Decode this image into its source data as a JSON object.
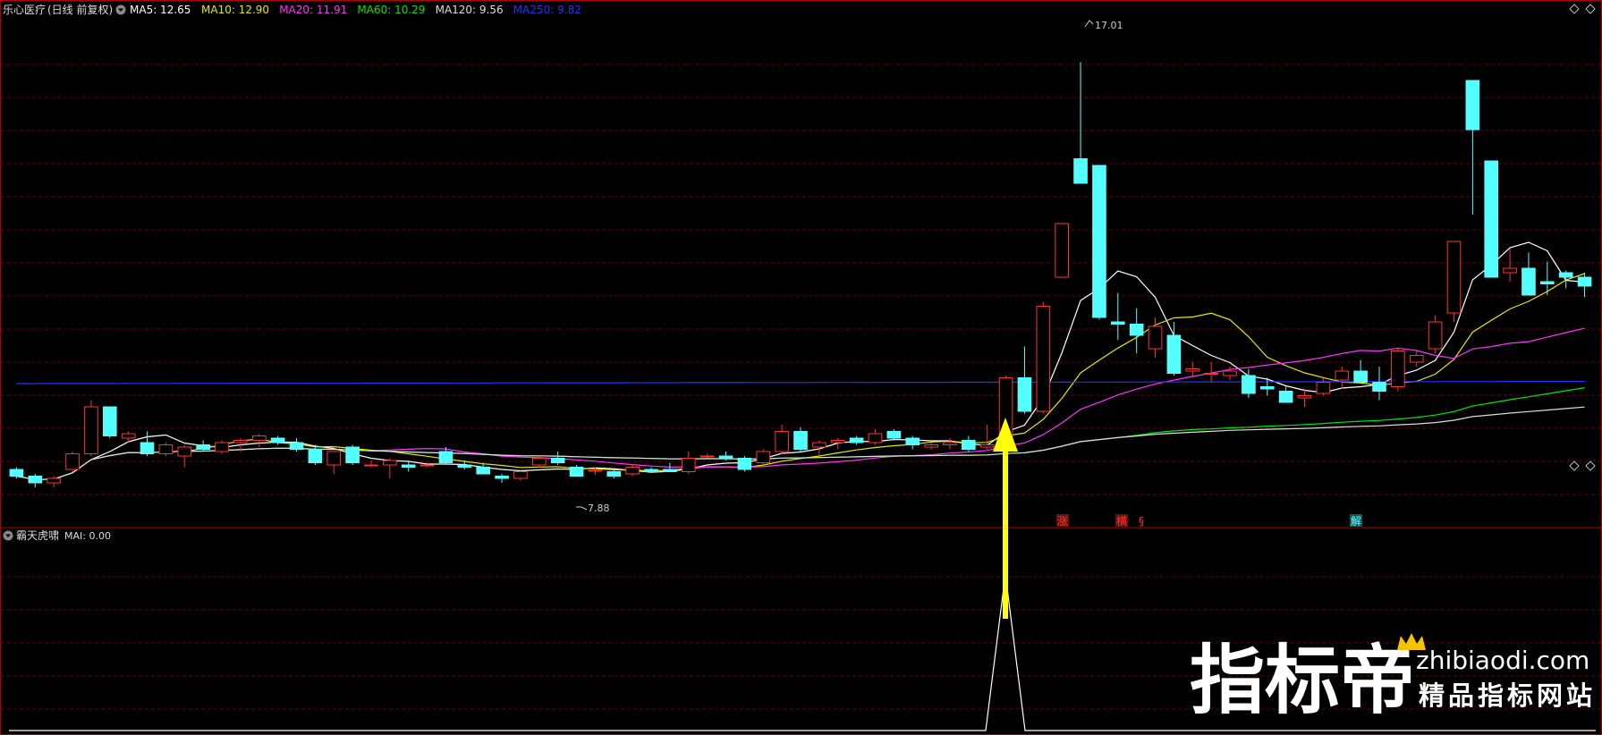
{
  "main_header": {
    "stock_name": "乐心医疗",
    "mode": "(日线 前复权)",
    "ma_items": [
      {
        "text": "MA5: 12.65",
        "color": "#ffffff"
      },
      {
        "text": "MA10: 12.90",
        "color": "#e8e800"
      },
      {
        "text": "MA20: 11.91",
        "color": "#ff33ff"
      },
      {
        "text": "MA60: 10.29",
        "color": "#00e800"
      },
      {
        "text": "MA120: 9.56",
        "color": "#dddddd"
      },
      {
        "text": "MA250: 9.82",
        "color": "#2233ff"
      }
    ]
  },
  "indicator_header": {
    "name": "霸天虎啸",
    "ma_text": "MAI: 0.00"
  },
  "price_markers": {
    "high_label": "17.01",
    "low_label": "7.88"
  },
  "signal_marks": [
    {
      "text": "涨",
      "color": "#ff3333",
      "bg": "#661111"
    },
    {
      "text": "横",
      "color": "#ff3333",
      "bg": "#661111"
    },
    {
      "text": "§",
      "color": "#ff3333",
      "bg": ""
    },
    {
      "text": "解",
      "color": "#66ffff",
      "bg": "#115555"
    }
  ],
  "watermark": {
    "brand": "指标帝",
    "domain": "zhibiaodi.com",
    "slogan": "精品指标网站"
  },
  "colors": {
    "up": "#ff3232",
    "down": "#54ffff",
    "grid": "#6a0000",
    "arrow": "#ffff00",
    "border": "#b00000"
  },
  "chart_data": {
    "type": "candlestick",
    "y_range": [
      7.0,
      18.0
    ],
    "candles": [
      [
        7.9,
        7.95,
        7.7,
        7.75
      ],
      [
        7.75,
        7.8,
        7.5,
        7.6
      ],
      [
        7.6,
        7.75,
        7.5,
        7.7
      ],
      [
        7.9,
        8.3,
        7.85,
        8.25
      ],
      [
        8.25,
        9.45,
        8.2,
        9.3
      ],
      [
        9.3,
        9.2,
        8.6,
        8.65
      ],
      [
        8.6,
        8.75,
        8.5,
        8.7
      ],
      [
        8.5,
        8.75,
        8.2,
        8.25
      ],
      [
        8.25,
        8.5,
        8.2,
        8.45
      ],
      [
        8.2,
        8.45,
        7.95,
        8.4
      ],
      [
        8.45,
        8.55,
        8.3,
        8.35
      ],
      [
        8.3,
        8.55,
        8.25,
        8.5
      ],
      [
        8.5,
        8.6,
        8.3,
        8.55
      ],
      [
        8.55,
        8.7,
        8.4,
        8.65
      ],
      [
        8.6,
        8.65,
        8.45,
        8.5
      ],
      [
        8.5,
        8.6,
        8.3,
        8.35
      ],
      [
        8.35,
        8.45,
        8.0,
        8.05
      ],
      [
        8.0,
        8.3,
        7.8,
        8.3
      ],
      [
        8.4,
        8.45,
        8.0,
        8.05
      ],
      [
        8.0,
        8.1,
        7.95,
        8.0
      ],
      [
        8.0,
        8.15,
        7.7,
        8.1
      ],
      [
        8.0,
        8.1,
        7.85,
        7.95
      ],
      [
        8.0,
        8.05,
        7.95,
        8.0
      ],
      [
        8.3,
        8.4,
        8.0,
        8.05
      ],
      [
        8.0,
        8.1,
        7.9,
        7.95
      ],
      [
        7.95,
        8.05,
        7.85,
        7.8
      ],
      [
        7.75,
        7.8,
        7.6,
        7.7
      ],
      [
        7.7,
        7.9,
        7.65,
        7.85
      ],
      [
        8.0,
        8.2,
        7.95,
        8.15
      ],
      [
        8.15,
        8.3,
        8.0,
        8.05
      ],
      [
        7.95,
        8.0,
        7.8,
        7.75
      ],
      [
        7.88,
        7.95,
        7.78,
        7.88
      ],
      [
        7.85,
        7.9,
        7.7,
        7.75
      ],
      [
        7.8,
        8.0,
        7.75,
        7.95
      ],
      [
        7.9,
        7.95,
        7.85,
        7.85
      ],
      [
        7.9,
        8.05,
        7.85,
        7.85
      ],
      [
        7.85,
        8.3,
        7.8,
        8.15
      ],
      [
        8.2,
        8.25,
        8.15,
        8.2
      ],
      [
        8.2,
        8.3,
        8.1,
        8.15
      ],
      [
        8.15,
        8.2,
        7.85,
        7.9
      ],
      [
        8.05,
        8.35,
        8.0,
        8.3
      ],
      [
        8.3,
        8.9,
        8.25,
        8.75
      ],
      [
        8.75,
        8.85,
        8.3,
        8.35
      ],
      [
        8.4,
        8.55,
        8.2,
        8.5
      ],
      [
        8.5,
        8.6,
        8.35,
        8.55
      ],
      [
        8.6,
        8.65,
        8.45,
        8.5
      ],
      [
        8.5,
        8.8,
        8.45,
        8.7
      ],
      [
        8.75,
        8.8,
        8.55,
        8.6
      ],
      [
        8.6,
        8.65,
        8.35,
        8.45
      ],
      [
        8.4,
        8.5,
        8.35,
        8.45
      ],
      [
        8.45,
        8.6,
        8.35,
        8.5
      ],
      [
        8.55,
        8.65,
        8.3,
        8.35
      ],
      [
        8.4,
        8.9,
        8.35,
        8.45
      ],
      [
        8.55,
        10.0,
        8.5,
        9.95
      ],
      [
        9.95,
        10.65,
        9.15,
        9.2
      ],
      [
        9.2,
        11.65,
        9.15,
        11.55
      ],
      [
        12.2,
        13.3,
        12.4,
        13.4
      ],
      [
        14.85,
        17.01,
        14.3,
        14.3
      ],
      [
        14.7,
        14.5,
        11.25,
        11.3
      ],
      [
        11.2,
        11.85,
        10.8,
        11.15
      ],
      [
        11.15,
        11.5,
        10.5,
        10.9
      ],
      [
        10.6,
        11.3,
        10.4,
        11.1
      ],
      [
        10.9,
        11.2,
        10.0,
        10.05
      ],
      [
        10.1,
        10.3,
        9.95,
        10.15
      ],
      [
        10.05,
        10.3,
        9.85,
        10.05
      ],
      [
        10.0,
        10.2,
        9.9,
        10.1
      ],
      [
        10.0,
        10.15,
        9.5,
        9.6
      ],
      [
        9.75,
        9.95,
        9.55,
        9.7
      ],
      [
        9.65,
        9.75,
        9.45,
        9.4
      ],
      [
        9.5,
        9.7,
        9.3,
        9.55
      ],
      [
        9.6,
        9.95,
        9.55,
        9.85
      ],
      [
        9.9,
        10.2,
        9.7,
        10.1
      ],
      [
        10.1,
        10.35,
        9.9,
        9.85
      ],
      [
        9.85,
        10.2,
        9.45,
        9.65
      ],
      [
        9.75,
        10.6,
        9.65,
        10.55
      ],
      [
        10.3,
        10.55,
        10.2,
        10.45
      ],
      [
        10.6,
        11.35,
        10.5,
        11.2
      ],
      [
        11.4,
        12.7,
        11.2,
        13.0
      ],
      [
        16.6,
        16.6,
        13.6,
        15.5
      ],
      [
        14.8,
        14.8,
        12.3,
        12.2
      ],
      [
        12.3,
        12.85,
        12.1,
        12.4
      ],
      [
        12.4,
        12.75,
        11.8,
        11.8
      ],
      [
        12.1,
        12.55,
        11.8,
        12.05
      ],
      [
        12.3,
        12.35,
        11.95,
        12.2
      ],
      [
        12.2,
        12.3,
        11.75,
        12.0
      ]
    ]
  }
}
